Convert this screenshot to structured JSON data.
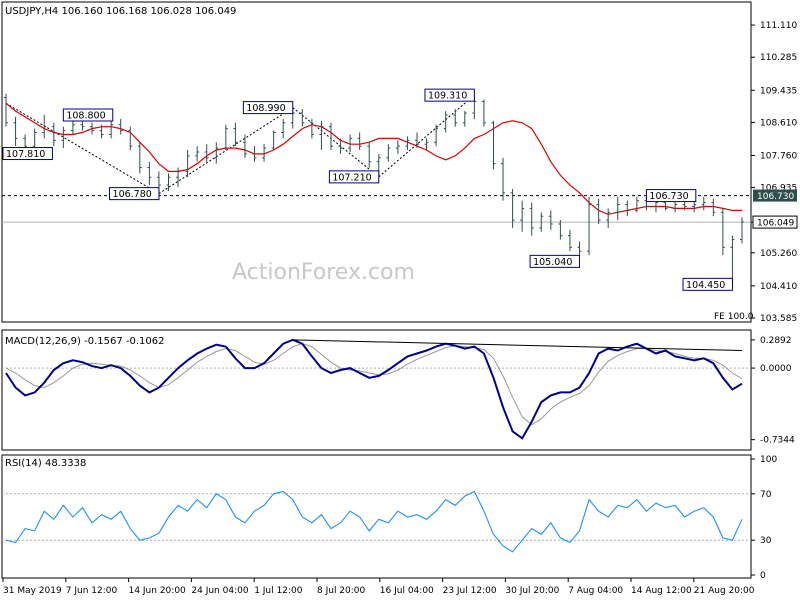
{
  "chart_data": [
    {
      "panel": "price",
      "type": "candlestick",
      "header": "USDJPY,H4  106.160 106.168 106.028 106.049",
      "watermark": "ActionForex.com",
      "ylim": [
        103.585,
        111.6
      ],
      "yticks": [
        "111.110",
        "110.285",
        "109.435",
        "108.610",
        "107.760",
        "106.935",
        "106.049",
        "105.260",
        "104.410",
        "103.585"
      ],
      "current_price": 106.049,
      "current_price_label": "106.049",
      "levels": [
        {
          "value": 106.73,
          "label": "106.730",
          "style": "dashed"
        }
      ],
      "annotations": [
        {
          "text": "108.800"
        },
        {
          "text": "107.810"
        },
        {
          "text": "106.780"
        },
        {
          "text": "108.990"
        },
        {
          "text": "107.210"
        },
        {
          "text": "109.310"
        },
        {
          "text": "105.040"
        },
        {
          "text": "106.730"
        },
        {
          "text": "104.450"
        }
      ],
      "fe_label": "FE 100.0",
      "series": [
        {
          "color": "#e00000",
          "values": [
            109.1,
            108.9,
            108.75,
            108.6,
            108.45,
            108.35,
            108.3,
            108.3,
            108.35,
            108.45,
            108.5,
            108.5,
            108.45,
            108.35,
            108.1,
            107.85,
            107.55,
            107.35,
            107.35,
            107.4,
            107.55,
            107.75,
            107.9,
            107.95,
            107.95,
            107.9,
            107.8,
            107.8,
            107.9,
            108.05,
            108.25,
            108.45,
            108.55,
            108.5,
            108.35,
            108.15,
            108.05,
            108.05,
            108.1,
            108.2,
            108.2,
            108.2,
            108.1,
            108.0,
            107.9,
            107.75,
            107.65,
            107.75,
            107.95,
            108.2,
            108.3,
            108.45,
            108.6,
            108.65,
            108.6,
            108.45,
            108.05,
            107.6,
            107.25,
            107.0,
            106.8,
            106.55,
            106.35,
            106.25,
            106.3,
            106.35,
            106.4,
            106.45,
            106.45,
            106.45,
            106.4,
            106.4,
            106.4,
            106.45,
            106.45,
            106.4,
            106.35,
            106.35
          ]
        }
      ],
      "candles": [
        {
          "t": 0,
          "o": 109.25,
          "h": 109.35,
          "l": 108.5,
          "c": 108.6
        },
        {
          "t": 1,
          "o": 108.6,
          "h": 108.75,
          "l": 108.0,
          "c": 108.2
        },
        {
          "t": 2,
          "o": 108.2,
          "h": 108.3,
          "l": 107.81,
          "c": 108.0
        },
        {
          "t": 3,
          "o": 108.0,
          "h": 108.45,
          "l": 107.9,
          "c": 108.35
        },
        {
          "t": 4,
          "o": 108.35,
          "h": 108.8,
          "l": 108.2,
          "c": 108.5
        },
        {
          "t": 5,
          "o": 108.5,
          "h": 108.6,
          "l": 108.0,
          "c": 108.15
        },
        {
          "t": 6,
          "o": 108.15,
          "h": 108.5,
          "l": 107.95,
          "c": 108.4
        },
        {
          "t": 7,
          "o": 108.4,
          "h": 108.75,
          "l": 108.3,
          "c": 108.55
        },
        {
          "t": 8,
          "o": 108.55,
          "h": 108.7,
          "l": 108.4,
          "c": 108.5
        },
        {
          "t": 9,
          "o": 108.5,
          "h": 108.6,
          "l": 108.3,
          "c": 108.4
        },
        {
          "t": 10,
          "o": 108.4,
          "h": 108.55,
          "l": 108.2,
          "c": 108.3
        },
        {
          "t": 11,
          "o": 108.3,
          "h": 108.65,
          "l": 108.2,
          "c": 108.55
        },
        {
          "t": 12,
          "o": 108.55,
          "h": 108.7,
          "l": 108.3,
          "c": 108.4
        },
        {
          "t": 13,
          "o": 108.4,
          "h": 108.5,
          "l": 107.9,
          "c": 108.0
        },
        {
          "t": 14,
          "o": 108.0,
          "h": 108.1,
          "l": 107.3,
          "c": 107.45
        },
        {
          "t": 15,
          "o": 107.45,
          "h": 107.6,
          "l": 107.0,
          "c": 107.2
        },
        {
          "t": 16,
          "o": 107.2,
          "h": 107.35,
          "l": 106.78,
          "c": 107.0
        },
        {
          "t": 17,
          "o": 107.0,
          "h": 107.3,
          "l": 106.85,
          "c": 107.2
        },
        {
          "t": 18,
          "o": 107.2,
          "h": 107.45,
          "l": 106.95,
          "c": 107.35
        },
        {
          "t": 19,
          "o": 107.35,
          "h": 107.9,
          "l": 107.2,
          "c": 107.75
        },
        {
          "t": 20,
          "o": 107.75,
          "h": 108.0,
          "l": 107.6,
          "c": 107.85
        },
        {
          "t": 21,
          "o": 107.85,
          "h": 108.05,
          "l": 107.55,
          "c": 107.7
        },
        {
          "t": 22,
          "o": 107.7,
          "h": 108.1,
          "l": 107.55,
          "c": 107.95
        },
        {
          "t": 23,
          "o": 107.95,
          "h": 108.55,
          "l": 107.9,
          "c": 108.45
        },
        {
          "t": 24,
          "o": 108.45,
          "h": 108.6,
          "l": 108.0,
          "c": 108.1
        },
        {
          "t": 25,
          "o": 108.1,
          "h": 108.3,
          "l": 107.7,
          "c": 107.8
        },
        {
          "t": 26,
          "o": 107.8,
          "h": 108.0,
          "l": 107.6,
          "c": 107.7
        },
        {
          "t": 27,
          "o": 107.7,
          "h": 108.05,
          "l": 107.6,
          "c": 107.95
        },
        {
          "t": 28,
          "o": 107.95,
          "h": 108.4,
          "l": 107.9,
          "c": 108.35
        },
        {
          "t": 29,
          "o": 108.35,
          "h": 108.7,
          "l": 108.2,
          "c": 108.6
        },
        {
          "t": 30,
          "o": 108.6,
          "h": 108.99,
          "l": 108.45,
          "c": 108.85
        },
        {
          "t": 31,
          "o": 108.85,
          "h": 108.95,
          "l": 108.5,
          "c": 108.6
        },
        {
          "t": 32,
          "o": 108.6,
          "h": 108.7,
          "l": 108.2,
          "c": 108.3
        },
        {
          "t": 33,
          "o": 108.3,
          "h": 108.65,
          "l": 107.9,
          "c": 108.5
        },
        {
          "t": 34,
          "o": 108.5,
          "h": 108.6,
          "l": 107.9,
          "c": 108.0
        },
        {
          "t": 35,
          "o": 108.0,
          "h": 108.2,
          "l": 107.8,
          "c": 107.95
        },
        {
          "t": 36,
          "o": 107.95,
          "h": 108.3,
          "l": 107.85,
          "c": 108.2
        },
        {
          "t": 37,
          "o": 108.2,
          "h": 108.35,
          "l": 107.9,
          "c": 108.0
        },
        {
          "t": 38,
          "o": 108.0,
          "h": 108.1,
          "l": 107.45,
          "c": 107.6
        },
        {
          "t": 39,
          "o": 107.6,
          "h": 107.8,
          "l": 107.21,
          "c": 107.7
        },
        {
          "t": 40,
          "o": 107.7,
          "h": 108.05,
          "l": 107.6,
          "c": 107.95
        },
        {
          "t": 41,
          "o": 107.95,
          "h": 108.15,
          "l": 107.8,
          "c": 108.0
        },
        {
          "t": 42,
          "o": 108.0,
          "h": 108.25,
          "l": 107.9,
          "c": 108.15
        },
        {
          "t": 43,
          "o": 108.15,
          "h": 108.35,
          "l": 107.95,
          "c": 108.05
        },
        {
          "t": 44,
          "o": 108.05,
          "h": 108.2,
          "l": 107.9,
          "c": 108.1
        },
        {
          "t": 45,
          "o": 108.1,
          "h": 108.55,
          "l": 108.0,
          "c": 108.45
        },
        {
          "t": 46,
          "o": 108.45,
          "h": 108.9,
          "l": 108.35,
          "c": 108.8
        },
        {
          "t": 47,
          "o": 108.8,
          "h": 108.95,
          "l": 108.5,
          "c": 108.6
        },
        {
          "t": 48,
          "o": 108.6,
          "h": 108.9,
          "l": 108.5,
          "c": 108.85
        },
        {
          "t": 49,
          "o": 108.85,
          "h": 109.31,
          "l": 108.7,
          "c": 109.15
        },
        {
          "t": 50,
          "o": 109.15,
          "h": 109.2,
          "l": 108.5,
          "c": 108.6
        },
        {
          "t": 51,
          "o": 108.6,
          "h": 108.65,
          "l": 107.4,
          "c": 107.55
        },
        {
          "t": 52,
          "o": 107.55,
          "h": 107.7,
          "l": 106.6,
          "c": 106.8
        },
        {
          "t": 53,
          "o": 106.8,
          "h": 106.9,
          "l": 105.9,
          "c": 106.1
        },
        {
          "t": 54,
          "o": 106.1,
          "h": 106.6,
          "l": 105.8,
          "c": 106.4
        },
        {
          "t": 55,
          "o": 106.4,
          "h": 106.55,
          "l": 105.7,
          "c": 105.9
        },
        {
          "t": 56,
          "o": 105.9,
          "h": 106.3,
          "l": 105.8,
          "c": 106.2
        },
        {
          "t": 57,
          "o": 106.2,
          "h": 106.35,
          "l": 105.85,
          "c": 106.0
        },
        {
          "t": 58,
          "o": 106.0,
          "h": 106.1,
          "l": 105.6,
          "c": 105.7
        },
        {
          "t": 59,
          "o": 105.7,
          "h": 105.85,
          "l": 105.3,
          "c": 105.4
        },
        {
          "t": 60,
          "o": 105.4,
          "h": 105.55,
          "l": 105.04,
          "c": 105.3
        },
        {
          "t": 61,
          "o": 105.3,
          "h": 106.7,
          "l": 105.2,
          "c": 106.5
        },
        {
          "t": 62,
          "o": 106.5,
          "h": 106.65,
          "l": 106.0,
          "c": 106.1
        },
        {
          "t": 63,
          "o": 106.1,
          "h": 106.4,
          "l": 105.9,
          "c": 106.3
        },
        {
          "t": 64,
          "o": 106.3,
          "h": 106.7,
          "l": 106.1,
          "c": 106.5
        },
        {
          "t": 65,
          "o": 106.5,
          "h": 106.6,
          "l": 106.2,
          "c": 106.35
        },
        {
          "t": 66,
          "o": 106.35,
          "h": 106.7,
          "l": 106.3,
          "c": 106.6
        },
        {
          "t": 67,
          "o": 106.6,
          "h": 106.73,
          "l": 106.35,
          "c": 106.45
        },
        {
          "t": 68,
          "o": 106.45,
          "h": 106.7,
          "l": 106.3,
          "c": 106.55
        },
        {
          "t": 69,
          "o": 106.55,
          "h": 106.65,
          "l": 106.35,
          "c": 106.4
        },
        {
          "t": 70,
          "o": 106.4,
          "h": 106.6,
          "l": 106.3,
          "c": 106.5
        },
        {
          "t": 71,
          "o": 106.5,
          "h": 106.7,
          "l": 106.35,
          "c": 106.45
        },
        {
          "t": 72,
          "o": 106.45,
          "h": 106.6,
          "l": 106.3,
          "c": 106.5
        },
        {
          "t": 73,
          "o": 106.5,
          "h": 106.7,
          "l": 106.35,
          "c": 106.55
        },
        {
          "t": 74,
          "o": 106.55,
          "h": 106.65,
          "l": 106.2,
          "c": 106.3
        },
        {
          "t": 75,
          "o": 106.3,
          "h": 106.4,
          "l": 105.2,
          "c": 105.4
        },
        {
          "t": 76,
          "o": 105.4,
          "h": 105.7,
          "l": 104.45,
          "c": 105.6
        },
        {
          "t": 77,
          "o": 105.6,
          "h": 106.17,
          "l": 105.5,
          "c": 106.05
        }
      ]
    },
    {
      "panel": "macd",
      "type": "line",
      "header": "MACD(12,26,9) -0.1567 -0.1062",
      "ylim": [
        -0.82,
        0.36
      ],
      "yticks": [
        "0.2892",
        "0.0000",
        "-0.7344"
      ],
      "series": [
        {
          "name": "MACD",
          "color": "#00008b",
          "values": [
            -0.05,
            -0.2,
            -0.28,
            -0.25,
            -0.15,
            -0.02,
            0.05,
            0.08,
            0.06,
            0.02,
            0.0,
            0.03,
            0.0,
            -0.08,
            -0.18,
            -0.25,
            -0.2,
            -0.1,
            0.0,
            0.08,
            0.15,
            0.2,
            0.24,
            0.22,
            0.1,
            0.0,
            0.0,
            0.05,
            0.15,
            0.25,
            0.29,
            0.25,
            0.12,
            0.0,
            -0.05,
            -0.02,
            0.0,
            -0.05,
            -0.1,
            -0.08,
            -0.02,
            0.05,
            0.12,
            0.15,
            0.18,
            0.22,
            0.25,
            0.23,
            0.2,
            0.22,
            0.15,
            -0.1,
            -0.4,
            -0.65,
            -0.72,
            -0.55,
            -0.35,
            -0.28,
            -0.25,
            -0.25,
            -0.2,
            -0.05,
            0.15,
            0.2,
            0.18,
            0.22,
            0.25,
            0.2,
            0.15,
            0.18,
            0.12,
            0.1,
            0.08,
            0.1,
            0.05,
            -0.1,
            -0.22,
            -0.16
          ]
        },
        {
          "name": "Signal",
          "color": "#999999",
          "values": [
            0.0,
            -0.05,
            -0.12,
            -0.18,
            -0.2,
            -0.15,
            -0.08,
            0.0,
            0.04,
            0.05,
            0.04,
            0.03,
            0.02,
            -0.02,
            -0.08,
            -0.15,
            -0.2,
            -0.17,
            -0.1,
            -0.02,
            0.06,
            0.12,
            0.17,
            0.2,
            0.18,
            0.12,
            0.06,
            0.04,
            0.08,
            0.15,
            0.22,
            0.25,
            0.22,
            0.14,
            0.06,
            0.0,
            -0.02,
            -0.03,
            -0.05,
            -0.07,
            -0.06,
            -0.02,
            0.04,
            0.09,
            0.13,
            0.17,
            0.21,
            0.23,
            0.22,
            0.21,
            0.19,
            0.1,
            -0.08,
            -0.3,
            -0.5,
            -0.58,
            -0.52,
            -0.42,
            -0.35,
            -0.3,
            -0.26,
            -0.18,
            -0.04,
            0.07,
            0.13,
            0.17,
            0.2,
            0.2,
            0.18,
            0.17,
            0.15,
            0.12,
            0.1,
            0.1,
            0.08,
            0.03,
            -0.05,
            -0.11
          ]
        }
      ],
      "trendline": [
        0.29,
        0.18
      ]
    },
    {
      "panel": "rsi",
      "type": "line",
      "header": "RSI(14) 48.3338",
      "ylim": [
        0,
        100
      ],
      "yticks": [
        "100",
        "70",
        "30",
        "0"
      ],
      "levels": [
        70,
        30
      ],
      "series": [
        {
          "name": "RSI",
          "color": "#1e90ff",
          "values": [
            30,
            28,
            40,
            38,
            55,
            48,
            60,
            50,
            58,
            45,
            52,
            48,
            55,
            40,
            30,
            32,
            36,
            50,
            60,
            55,
            65,
            58,
            70,
            65,
            50,
            45,
            55,
            60,
            70,
            72,
            65,
            50,
            45,
            52,
            40,
            45,
            55,
            50,
            38,
            48,
            45,
            55,
            50,
            52,
            48,
            55,
            65,
            60,
            68,
            72,
            55,
            35,
            25,
            20,
            30,
            40,
            35,
            45,
            32,
            28,
            38,
            65,
            55,
            50,
            60,
            58,
            65,
            55,
            62,
            58,
            60,
            50,
            55,
            58,
            50,
            32,
            30,
            48
          ]
        }
      ]
    }
  ],
  "time_axis": {
    "labels": [
      "31 May 2019",
      "7 Jun 12:00",
      "14 Jun 20:00",
      "24 Jun 04:00",
      "1 Jul 12:00",
      "8 Jul 20:00",
      "16 Jul 04:00",
      "23 Jul 12:00",
      "30 Jul 20:00",
      "7 Aug 04:00",
      "14 Aug 12:00",
      "21 Aug 20:00"
    ]
  },
  "colors": {
    "bull": "#2f4f4f",
    "bear": "#2f4f4f",
    "ma": "#e00000",
    "macd": "#00008b",
    "signal": "#999999",
    "rsi": "#1e90ff",
    "label_border": "#00008b",
    "axis_text": "#000000"
  }
}
